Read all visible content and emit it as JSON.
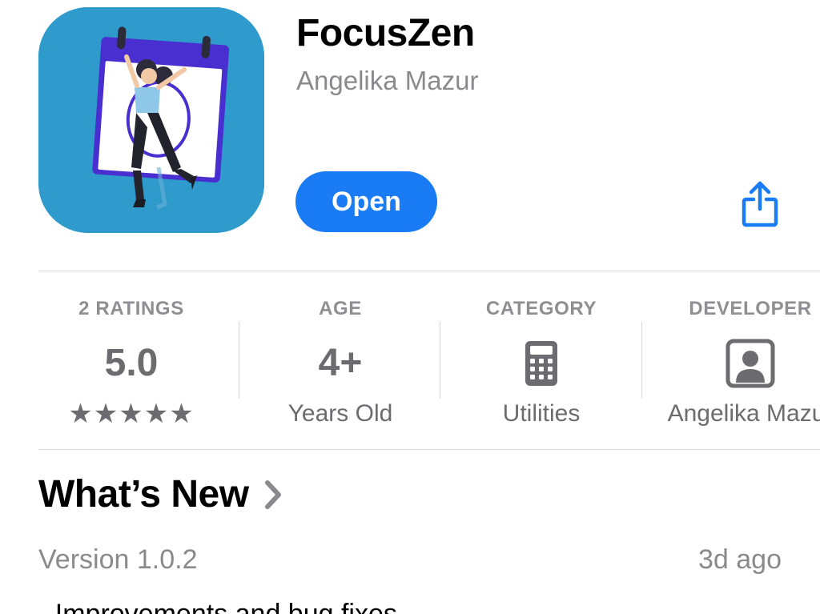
{
  "app": {
    "name": "FocusZen",
    "developer": "Angelika Mazur",
    "open_label": "Open",
    "icon": "app-icon-calendar-person",
    "share_icon": "share-icon"
  },
  "info": [
    {
      "header": "2 RATINGS",
      "main": "5.0",
      "sub": "★★★★★"
    },
    {
      "header": "AGE",
      "main": "4+",
      "sub": "Years Old"
    },
    {
      "header": "CATEGORY",
      "main_icon": "calculator-icon",
      "sub": "Utilities"
    },
    {
      "header": "DEVELOPER",
      "main_icon": "person-icon",
      "sub": "Angelika Mazur"
    }
  ],
  "whats_new": {
    "title": "What’s New",
    "version": "Version 1.0.2",
    "date": "3d ago",
    "notes": "- Improvements and bug fixes"
  },
  "colors": {
    "accent": "#1a7cf5",
    "icon_bg": "#2f9bcc",
    "secondary_text": "#8a8a8e",
    "info_text": "#6b6b70"
  }
}
